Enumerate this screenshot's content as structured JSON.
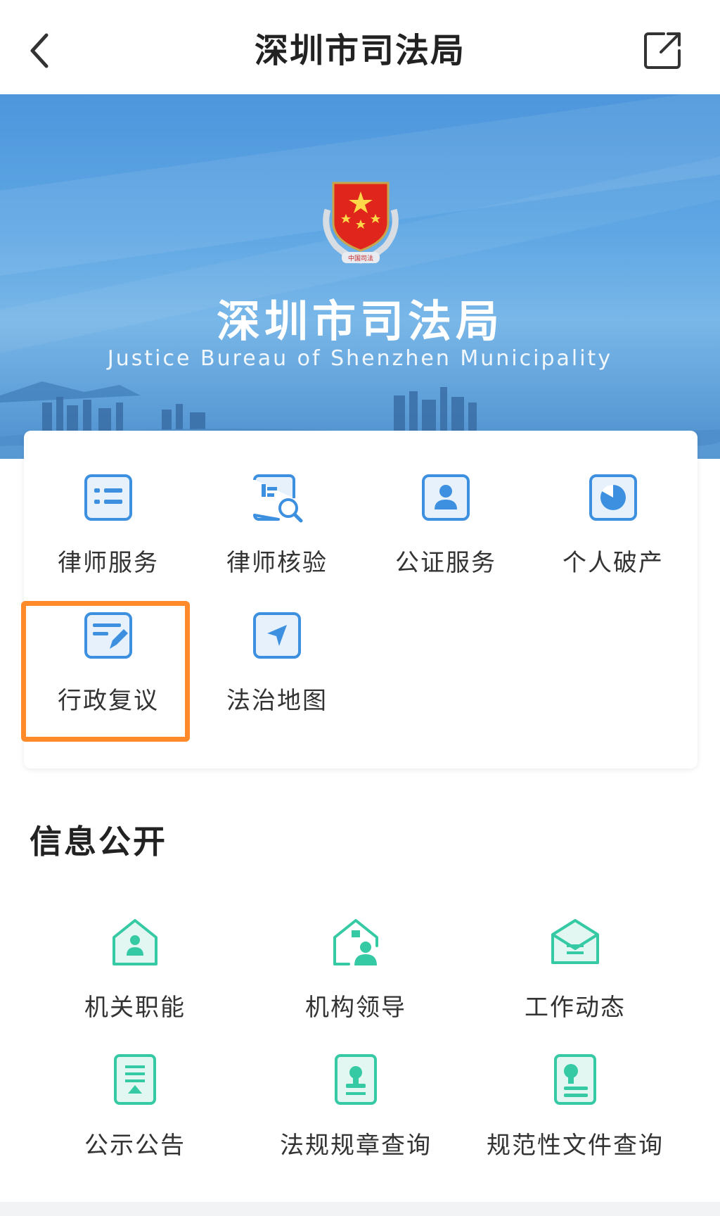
{
  "nav": {
    "title": "深圳市司法局"
  },
  "banner": {
    "title": "深圳市司法局",
    "subtitle": "Justice Bureau of Shenzhen Municipality",
    "emblem_text": "中国司法"
  },
  "services": [
    {
      "label": "律师服务",
      "icon": "list-document-icon"
    },
    {
      "label": "律师核验",
      "icon": "document-search-icon"
    },
    {
      "label": "公证服务",
      "icon": "person-card-icon"
    },
    {
      "label": "个人破产",
      "icon": "pie-chart-icon"
    },
    {
      "label": "行政复议",
      "icon": "edit-document-icon",
      "highlighted": true
    },
    {
      "label": "法治地图",
      "icon": "navigation-map-icon"
    }
  ],
  "info_section": {
    "title": "信息公开",
    "items": [
      {
        "label": "机关职能",
        "icon": "house-person-icon"
      },
      {
        "label": "机构领导",
        "icon": "house-leader-icon"
      },
      {
        "label": "工作动态",
        "icon": "open-envelope-icon"
      },
      {
        "label": "公示公告",
        "icon": "notice-document-icon"
      },
      {
        "label": "法规规章查询",
        "icon": "stamp-document-icon"
      },
      {
        "label": "规范性文件查询",
        "icon": "normative-document-icon"
      }
    ]
  },
  "colors": {
    "accent_blue": "#3d8fe0",
    "accent_green": "#35c9a4",
    "highlight_orange": "#ff8a2a"
  }
}
